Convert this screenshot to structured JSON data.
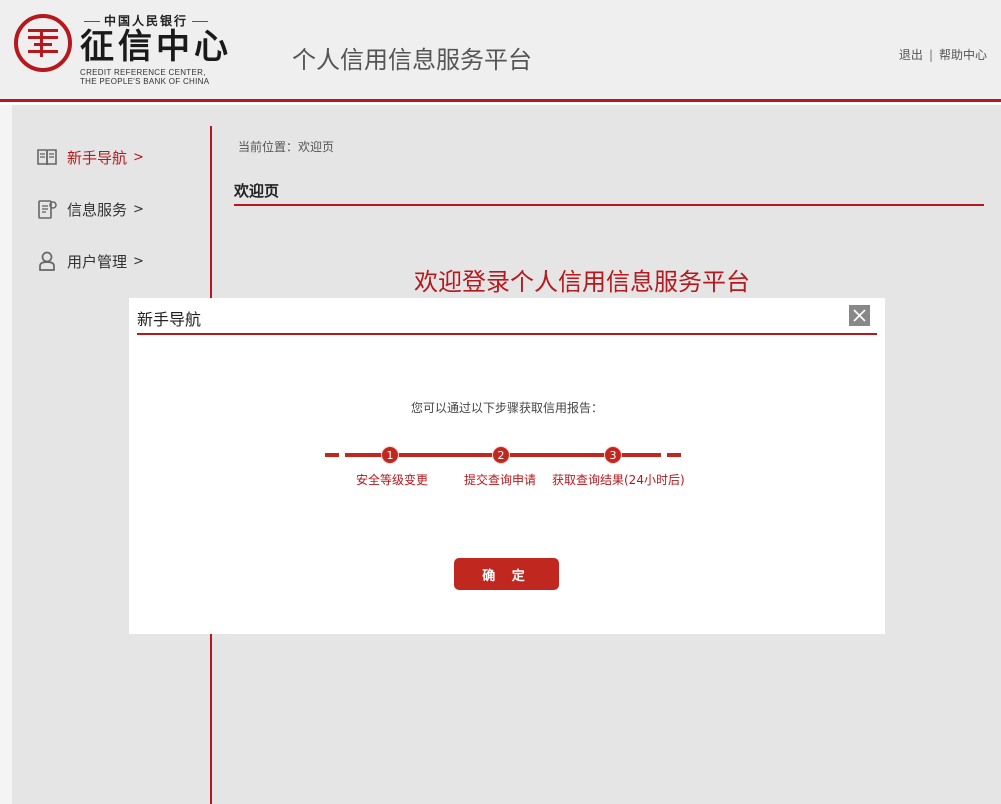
{
  "header": {
    "logo": {
      "top_text": "中国人民银行",
      "name": "征信中心",
      "en_line1": "CREDIT REFERENCE CENTER,",
      "en_line2": "THE PEOPLE'S BANK OF CHINA"
    },
    "platform_title": "个人信用信息服务平台",
    "links": {
      "logout": "退出",
      "separator": "|",
      "help": "帮助中心"
    }
  },
  "sidebar": {
    "items": [
      {
        "label": "新手导航",
        "chevron": ">",
        "icon": "book-icon",
        "active": true
      },
      {
        "label": "信息服务",
        "chevron": ">",
        "icon": "document-icon",
        "active": false
      },
      {
        "label": "用户管理",
        "chevron": ">",
        "icon": "user-icon",
        "active": false
      }
    ]
  },
  "main": {
    "breadcrumb": "当前位置：欢迎页",
    "heading": "欢迎页",
    "welcome_text": "欢迎登录个人信用信息服务平台"
  },
  "modal": {
    "title": "新手导航",
    "close_icon": "close-icon",
    "intro": "您可以通过以下步骤获取信用报告：",
    "steps": [
      {
        "number": "1",
        "label": "安全等级变更"
      },
      {
        "number": "2",
        "label": "提交查询申请"
      },
      {
        "number": "3",
        "label": "获取查询结果(24小时后)"
      }
    ],
    "confirm_label": "确 定"
  },
  "colors": {
    "brand_red": "#b5191d",
    "step_red": "#c0281f",
    "header_bg": "#efefef",
    "content_bg": "#e5e5e5"
  }
}
